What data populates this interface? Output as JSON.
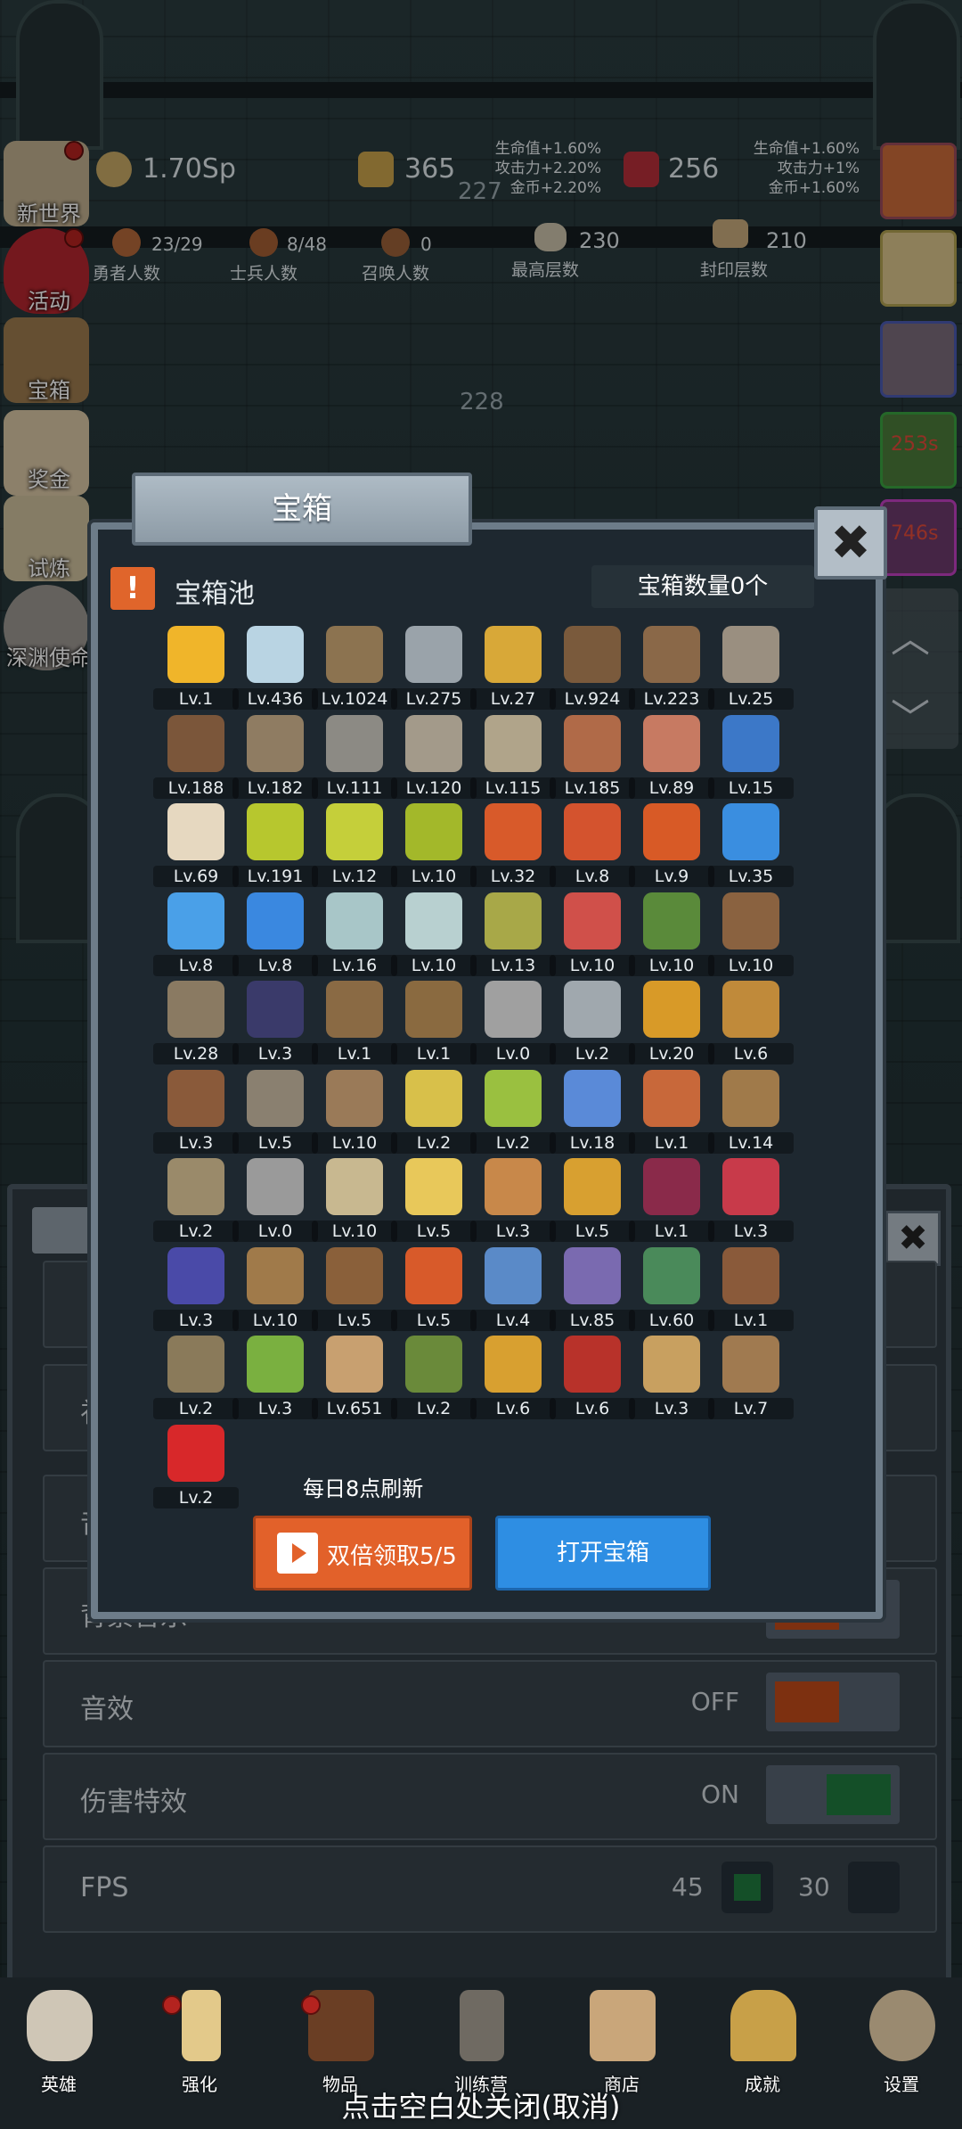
{
  "hud": {
    "gold": "1.70Sp",
    "bars": "365",
    "gems": "256",
    "floor_top": "227",
    "floor_mid": "228",
    "bonus_left": [
      "生命值+1.60%",
      "攻击力+2.20%",
      "金币+2.20%"
    ],
    "bonus_right": [
      "生命值+1.60%",
      "攻击力+1%",
      "金币+1.60%"
    ],
    "heroes": {
      "value": "23/29",
      "label": "勇者人数"
    },
    "soldiers": {
      "value": "8/48",
      "label": "士兵人数"
    },
    "summons": {
      "value": "0",
      "label": "召唤人数"
    },
    "max_floor": {
      "value": "230",
      "label": "最高层数"
    },
    "seal_floor": {
      "value": "210",
      "label": "封印层数"
    },
    "timer_1": "253s",
    "timer_2": "746s"
  },
  "left_menu": [
    "新世界",
    "活动",
    "宝箱",
    "奖金",
    "试炼",
    "深渊使命"
  ],
  "settings": {
    "rows": [
      {
        "label": "礼",
        "value": ""
      },
      {
        "label": "音",
        "value": ""
      },
      {
        "label": "背景音乐",
        "value": "OFF"
      },
      {
        "label": "音效",
        "value": "OFF"
      },
      {
        "label": "伤害特效",
        "value": "ON"
      },
      {
        "label": "FPS",
        "value": ""
      }
    ],
    "fps_a": "45",
    "fps_b": "30"
  },
  "dialog": {
    "title": "宝箱",
    "pool_title": "宝箱池",
    "pool_icon": "!",
    "chest_count": "宝箱数量0个",
    "close_icon": "✖",
    "refresh_text": "每日8点刷新",
    "double_button": "双倍领取5/5",
    "open_button": "打开宝箱",
    "items": [
      {
        "lv": "Lv.1",
        "c": "#f0b52a"
      },
      {
        "lv": "Lv.436",
        "c": "#b9d4e3"
      },
      {
        "lv": "Lv.1024",
        "c": "#8c7350"
      },
      {
        "lv": "Lv.275",
        "c": "#9aa3aa"
      },
      {
        "lv": "Lv.27",
        "c": "#d8a838"
      },
      {
        "lv": "Lv.924",
        "c": "#7a5a3c"
      },
      {
        "lv": "Lv.223",
        "c": "#8a6848"
      },
      {
        "lv": "Lv.25",
        "c": "#9a8f80"
      },
      {
        "lv": "Lv.188",
        "c": "#7b563a"
      },
      {
        "lv": "Lv.182",
        "c": "#8f7c62"
      },
      {
        "lv": "Lv.111",
        "c": "#8c8a84"
      },
      {
        "lv": "Lv.120",
        "c": "#a39a8a"
      },
      {
        "lv": "Lv.115",
        "c": "#b0a48a"
      },
      {
        "lv": "Lv.185",
        "c": "#b06a48"
      },
      {
        "lv": "Lv.89",
        "c": "#c77a62"
      },
      {
        "lv": "Lv.15",
        "c": "#3c78c8"
      },
      {
        "lv": "Lv.69",
        "c": "#e6d8c0"
      },
      {
        "lv": "Lv.191",
        "c": "#b7c72e"
      },
      {
        "lv": "Lv.12",
        "c": "#c5cf3a"
      },
      {
        "lv": "Lv.10",
        "c": "#a3b82a"
      },
      {
        "lv": "Lv.32",
        "c": "#d85a2a"
      },
      {
        "lv": "Lv.8",
        "c": "#d4532e"
      },
      {
        "lv": "Lv.9",
        "c": "#d85a26"
      },
      {
        "lv": "Lv.35",
        "c": "#3a8ee0"
      },
      {
        "lv": "Lv.8",
        "c": "#4aa0e8"
      },
      {
        "lv": "Lv.8",
        "c": "#3a88e0"
      },
      {
        "lv": "Lv.16",
        "c": "#a8c6c8"
      },
      {
        "lv": "Lv.10",
        "c": "#b8d0d0"
      },
      {
        "lv": "Lv.13",
        "c": "#a8a848"
      },
      {
        "lv": "Lv.10",
        "c": "#d0504a"
      },
      {
        "lv": "Lv.10",
        "c": "#5a8a3a"
      },
      {
        "lv": "Lv.10",
        "c": "#8a6240"
      },
      {
        "lv": "Lv.28",
        "c": "#8a7a62"
      },
      {
        "lv": "Lv.3",
        "c": "#3a3a6a"
      },
      {
        "lv": "Lv.1",
        "c": "#8a6a44"
      },
      {
        "lv": "Lv.1",
        "c": "#8a6a40"
      },
      {
        "lv": "Lv.0",
        "c": "#a0a0a0"
      },
      {
        "lv": "Lv.2",
        "c": "#a0a8ae"
      },
      {
        "lv": "Lv.20",
        "c": "#d89a28"
      },
      {
        "lv": "Lv.6",
        "c": "#c08a3a"
      },
      {
        "lv": "Lv.3",
        "c": "#8a5a3a"
      },
      {
        "lv": "Lv.5",
        "c": "#8a8070"
      },
      {
        "lv": "Lv.10",
        "c": "#9a7a58"
      },
      {
        "lv": "Lv.2",
        "c": "#d8c04a"
      },
      {
        "lv": "Lv.2",
        "c": "#9ac040"
      },
      {
        "lv": "Lv.18",
        "c": "#5a8ad8"
      },
      {
        "lv": "Lv.1",
        "c": "#c8683a"
      },
      {
        "lv": "Lv.14",
        "c": "#a07a4a"
      },
      {
        "lv": "Lv.2",
        "c": "#9a8a6a"
      },
      {
        "lv": "Lv.0",
        "c": "#9a9a9a"
      },
      {
        "lv": "Lv.10",
        "c": "#c8b890"
      },
      {
        "lv": "Lv.5",
        "c": "#e8c85a"
      },
      {
        "lv": "Lv.3",
        "c": "#c8884a"
      },
      {
        "lv": "Lv.5",
        "c": "#d8a030"
      },
      {
        "lv": "Lv.1",
        "c": "#8a2a4a"
      },
      {
        "lv": "Lv.3",
        "c": "#c83a4a"
      },
      {
        "lv": "Lv.3",
        "c": "#4a4aa8"
      },
      {
        "lv": "Lv.10",
        "c": "#a07a4a"
      },
      {
        "lv": "Lv.5",
        "c": "#8a603a"
      },
      {
        "lv": "Lv.5",
        "c": "#d85a2a"
      },
      {
        "lv": "Lv.4",
        "c": "#5a8ac8"
      },
      {
        "lv": "Lv.85",
        "c": "#7a6ab0"
      },
      {
        "lv": "Lv.60",
        "c": "#4a8a5a"
      },
      {
        "lv": "Lv.1",
        "c": "#8a5a3a"
      },
      {
        "lv": "Lv.2",
        "c": "#8a7a5a"
      },
      {
        "lv": "Lv.3",
        "c": "#7ab040"
      },
      {
        "lv": "Lv.651",
        "c": "#c8a070"
      },
      {
        "lv": "Lv.2",
        "c": "#6a8a3a"
      },
      {
        "lv": "Lv.6",
        "c": "#d8a030"
      },
      {
        "lv": "Lv.6",
        "c": "#b8322a"
      },
      {
        "lv": "Lv.3",
        "c": "#c8a060"
      },
      {
        "lv": "Lv.7",
        "c": "#a07a50"
      },
      {
        "lv": "Lv.2",
        "c": "#d8282a"
      }
    ]
  },
  "bottom_nav": [
    "英雄",
    "强化",
    "物品",
    "训练营",
    "商店",
    "成就",
    "设置"
  ],
  "close_hint": "点击空白处关闭(取消)"
}
